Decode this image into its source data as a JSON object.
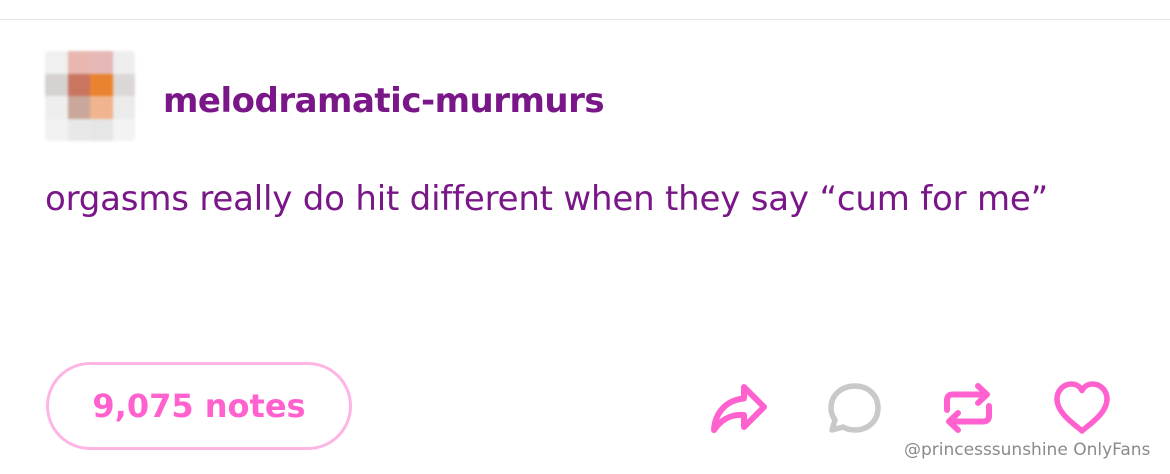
{
  "post": {
    "username": "melodramatic-murmurs",
    "body": "orgasms really do hit different when they say “cum for me”",
    "notes_label": "9,075 notes"
  },
  "actions": {
    "share_icon": "share-arrow-icon",
    "reply_icon": "speech-bubble-icon",
    "reblog_icon": "reblog-icon",
    "like_icon": "heart-icon"
  },
  "watermark": "@princesssunshine OnlyFans",
  "colors": {
    "text_purple": "#7a1788",
    "accent_pink": "#ff62ce",
    "pill_border": "#ffb5e4",
    "reply_gray": "#c9c9c9",
    "watermark_gray": "#8a8a8a",
    "avatar_pixels": [
      "#f0f0f0",
      "#e8b8b0",
      "#e6b8b6",
      "#eeeeee",
      "#d6d2d2",
      "#c97560",
      "#e9832f",
      "#dcd7d7",
      "#eeeeee",
      "#c9a79a",
      "#f0b48e",
      "#ebebeb",
      "#f2f2f2",
      "#e8e8e8",
      "#e6e6e6",
      "#f3f3f3"
    ]
  }
}
